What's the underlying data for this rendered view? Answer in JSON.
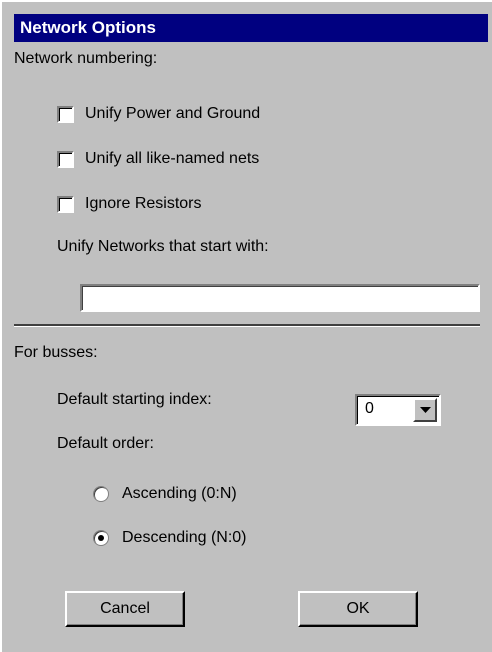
{
  "window": {
    "title": "Network Options"
  },
  "network": {
    "section_label": "Network numbering:",
    "checkboxes": [
      {
        "label": "Unify Power and Ground",
        "checked": false
      },
      {
        "label": "Unify all like-named nets",
        "checked": false
      },
      {
        "label": "Ignore Resistors",
        "checked": false
      }
    ],
    "prefix_label": "Unify Networks that start with:",
    "prefix_value": ""
  },
  "busses": {
    "section_label": "For busses:",
    "start_index_label": "Default starting index:",
    "start_index_value": "0",
    "order_label": "Default order:",
    "orders": [
      {
        "label": "Ascending (0:N)",
        "selected": false
      },
      {
        "label": "Descending (N:0)",
        "selected": true
      }
    ]
  },
  "buttons": {
    "cancel": "Cancel",
    "ok": "OK"
  }
}
